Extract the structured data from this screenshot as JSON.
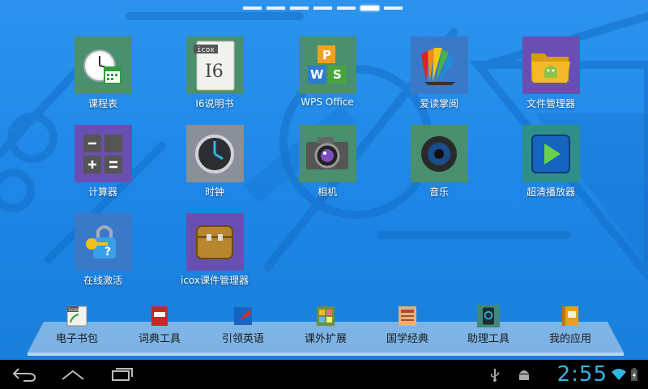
{
  "pager": {
    "count": 7,
    "active_index": 5
  },
  "apps": [
    {
      "label": "课程表",
      "icon": "calendar-clock-icon"
    },
    {
      "label": "I6说明书",
      "icon": "manual-document-icon",
      "doc_tag": "icox",
      "doc_title": "I6"
    },
    {
      "label": "WPS Office",
      "icon": "wps-office-icon"
    },
    {
      "label": "爱读掌阅",
      "icon": "book-reader-icon"
    },
    {
      "label": "文件管理器",
      "icon": "folder-android-icon"
    },
    {
      "label": "计算器",
      "icon": "calculator-icon"
    },
    {
      "label": "时钟",
      "icon": "clock-icon"
    },
    {
      "label": "相机",
      "icon": "camera-icon"
    },
    {
      "label": "音乐",
      "icon": "speaker-icon"
    },
    {
      "label": "超清播放器",
      "icon": "video-player-icon"
    },
    {
      "label": "在线激活",
      "icon": "key-lock-icon"
    },
    {
      "label": "icox课件管理器",
      "icon": "briefcase-icon"
    }
  ],
  "dock": [
    {
      "label": "电子书包",
      "icon": "ebook-bag-icon",
      "tag": "icox"
    },
    {
      "label": "词典工具",
      "icon": "dictionary-icon"
    },
    {
      "label": "引领英语",
      "icon": "english-book-icon"
    },
    {
      "label": "课外扩展",
      "icon": "extension-book-icon"
    },
    {
      "label": "国学经典",
      "icon": "classics-book-icon"
    },
    {
      "label": "助理工具",
      "icon": "assistant-tool-icon"
    },
    {
      "label": "我的应用",
      "icon": "my-apps-icon"
    }
  ],
  "status": {
    "time": "2:55"
  },
  "colors": {
    "accent": "#33b5e5",
    "wallpaper": "#1e88e8"
  }
}
